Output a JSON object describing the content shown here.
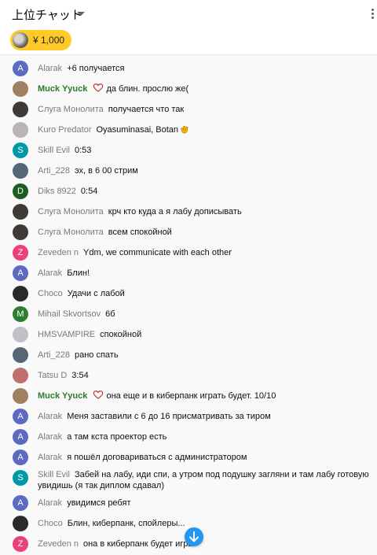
{
  "header": {
    "title": "上位チャット"
  },
  "ticker": {
    "superchat_amount": "¥ 1,000"
  },
  "colors": {
    "accent_blue": "#2196f3",
    "superchat_yellow": "#ffca28",
    "member_green": "#2b7a2b"
  },
  "messages": [
    {
      "author": "Alarak",
      "text": "+6 получается",
      "avatar": "A",
      "avatar_color": "#5c6bc0"
    },
    {
      "author": "Muck Yyuck",
      "text": "да блин. прослю же(",
      "member": true,
      "avatar_color": "#a08060"
    },
    {
      "author": "Слуга Монолита",
      "text": "получается что так",
      "avatar_color": "#3e3a36"
    },
    {
      "author": "Kuro Predator",
      "text": "Oyasuminasai, Botan",
      "emoji": "clap",
      "avatar_color": "#b8b4b8"
    },
    {
      "author": "Skill Evil",
      "text": "0:53",
      "avatar": "S",
      "avatar_color": "#0097a7"
    },
    {
      "author": "Arti_228",
      "text": "эх, в 6 00 стрим",
      "avatar_color": "#556677"
    },
    {
      "author": "Diks 8922",
      "text": "0:54",
      "avatar": "D",
      "avatar_color": "#1b5e20"
    },
    {
      "author": "Слуга Монолита",
      "text": "крч кто куда а я лабу дописывать",
      "avatar_color": "#3e3a36"
    },
    {
      "author": "Слуга Монолита",
      "text": "всем спокойной",
      "avatar_color": "#3e3a36"
    },
    {
      "author": "Zeveden n",
      "text": "Ydm, we communicate with each other",
      "avatar": "Z",
      "avatar_color": "#ec407a"
    },
    {
      "author": "Alarak",
      "text": "Блин!",
      "avatar": "A",
      "avatar_color": "#5c6bc0"
    },
    {
      "author": "Choco",
      "text": "Удачи с лабой",
      "avatar_color": "#2a2a2a"
    },
    {
      "author": "Mihail Skvortsov",
      "text": "6б",
      "avatar": "M",
      "avatar_color": "#2e7d32"
    },
    {
      "author": "HMSVAMPIRE",
      "text": "спокойной",
      "avatar_color": "#c0c0c8"
    },
    {
      "author": "Arti_228",
      "text": "рано спать",
      "avatar_color": "#556677"
    },
    {
      "author": "Tatsu D",
      "text": "3:54",
      "avatar_color": "#c07070"
    },
    {
      "author": "Muck Yyuck",
      "text": "она еще и в киберпанк играть будет. 10/10",
      "member": true,
      "avatar_color": "#a08060"
    },
    {
      "author": "Alarak",
      "text": "Меня заставили с 6 до 16 присматривать за тиром",
      "avatar": "A",
      "avatar_color": "#5c6bc0"
    },
    {
      "author": "Alarak",
      "text": "а там кста проектор есть",
      "avatar": "A",
      "avatar_color": "#5c6bc0"
    },
    {
      "author": "Alarak",
      "text": "я пошёл договариваться с администратором",
      "avatar": "A",
      "avatar_color": "#5c6bc0"
    },
    {
      "author": "Skill Evil",
      "text": "Забей на лабу, иди спи, а утром под подушку загляни и там лабу готовую увидишь (я так диплом сдавал)",
      "avatar": "S",
      "avatar_color": "#0097a7"
    },
    {
      "author": "Alarak",
      "text": "увидимся ребят",
      "avatar": "A",
      "avatar_color": "#5c6bc0"
    },
    {
      "author": "Choco",
      "text": "Блин, киберпанк, спойлеры...",
      "avatar_color": "#2a2a2a"
    },
    {
      "author": "Zeveden n",
      "text": "она в киберпанк будет игра",
      "avatar": "Z",
      "avatar_color": "#ec407a"
    }
  ]
}
